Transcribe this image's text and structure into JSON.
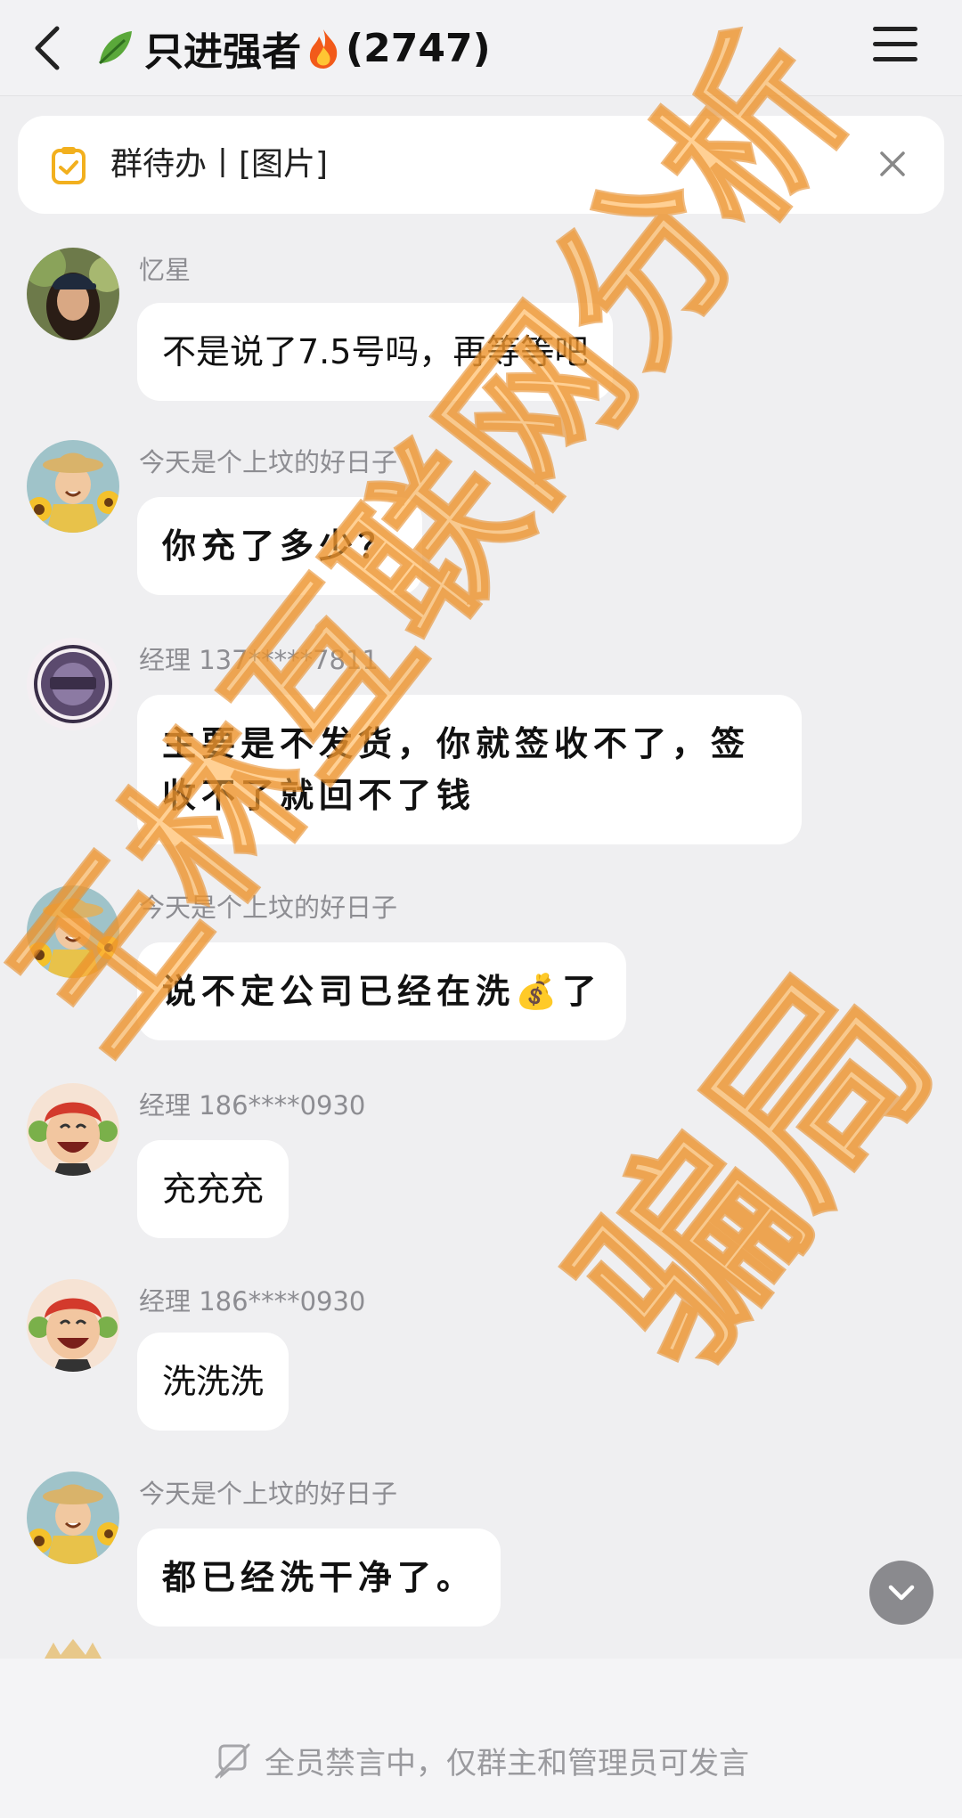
{
  "header": {
    "title": "只进强者",
    "member_count": "(2747)",
    "icons": {
      "back": "chevron-left-icon",
      "menu": "hamburger-menu-icon",
      "leaf": "leaf-emoji",
      "fire": "fire-emoji"
    }
  },
  "todo_banner": {
    "text": "群待办丨[图片]",
    "icons": {
      "todo": "clipboard-check-icon",
      "close": "close-icon"
    }
  },
  "messages": [
    {
      "sender": "忆星",
      "text": "不是说了7.5号吗，再等等吧",
      "avatar": "girl-cap-photo"
    },
    {
      "sender": "今天是个上坟的好日子",
      "text": "你充了多少？",
      "avatar": "sunflower-farmer-cartoon"
    },
    {
      "sender": "经理 137*****7811",
      "text": "主要是不发货，你就签收不了，签收不了就回不了钱",
      "avatar": "purple-badge-avatar"
    },
    {
      "sender": "今天是个上坟的好日子",
      "text": "说不定公司已经在洗💰了",
      "avatar": "sunflower-farmer-cartoon"
    },
    {
      "sender": "经理 186****0930",
      "text": "充充充",
      "avatar": "red-hair-laughing-cartoon"
    },
    {
      "sender": "经理 186****0930",
      "text": "洗洗洗",
      "avatar": "red-hair-laughing-cartoon"
    },
    {
      "sender": "今天是个上坟的好日子",
      "text": "都已经洗干净了。",
      "avatar": "sunflower-farmer-cartoon"
    }
  ],
  "footer": {
    "mute_notice": "全员禁言中，仅群主和管理员可发言",
    "icons": {
      "ban": "no-speaking-icon",
      "scroll": "chevron-down-icon"
    }
  },
  "watermark": {
    "line1": "王林互联网分析",
    "line2": "骗局"
  },
  "colors": {
    "background": "#efeff1",
    "bubble": "#ffffff",
    "watermark": "#ffaa3c",
    "todo_icon": "#f2b01e"
  }
}
